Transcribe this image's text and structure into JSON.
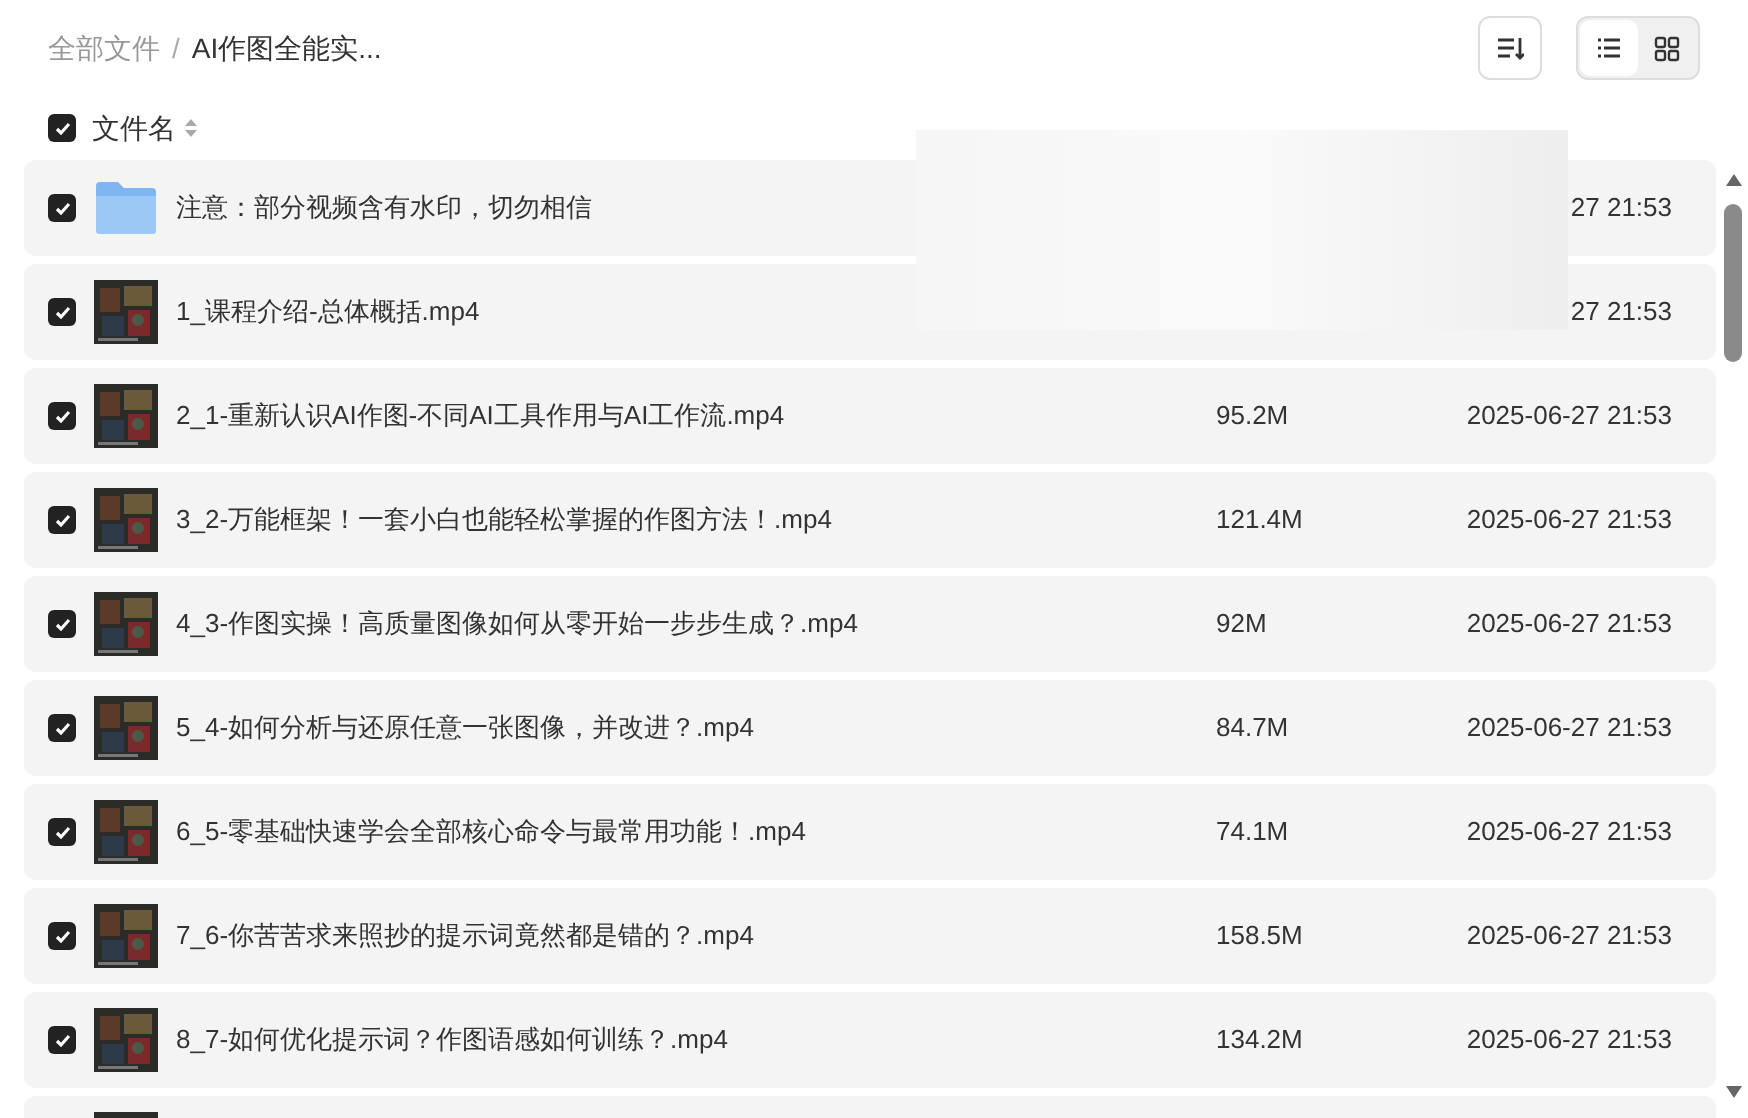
{
  "breadcrumb": {
    "items": [
      "全部文件",
      "AI作图全能实..."
    ],
    "separator": "/"
  },
  "view_modes": [
    {
      "kind": "list",
      "selected": true
    },
    {
      "kind": "grid",
      "selected": false
    }
  ],
  "header": {
    "checked": true,
    "columns": [
      "文件名"
    ]
  },
  "rows": [
    {
      "kind": "folder",
      "checked": true,
      "name": "注意：部分视频含有水印，切勿相信",
      "date": "27 21:53"
    },
    {
      "kind": "video",
      "checked": true,
      "name": "1_课程介绍-总体概括.mp4",
      "date": "27 21:53"
    },
    {
      "kind": "video",
      "checked": true,
      "name": "2_1-重新认识AI作图-不同AI工具作用与AI工作流.mp4",
      "size": "95.2M",
      "date": "2025-06-27 21:53"
    },
    {
      "kind": "video",
      "checked": true,
      "name": "3_2-万能框架！一套小白也能轻松掌握的作图方法！.mp4",
      "size": "121.4M",
      "date": "2025-06-27 21:53"
    },
    {
      "kind": "video",
      "checked": true,
      "name": "4_3-作图实操！高质量图像如何从零开始一步步生成？.mp4",
      "size": "92M",
      "date": "2025-06-27 21:53"
    },
    {
      "kind": "video",
      "checked": true,
      "name": "5_4-如何分析与还原任意一张图像，并改进？.mp4",
      "size": "84.7M",
      "date": "2025-06-27 21:53"
    },
    {
      "kind": "video",
      "checked": true,
      "name": "6_5-零基础快速学会全部核心命令与最常用功能！.mp4",
      "size": "74.1M",
      "date": "2025-06-27 21:53"
    },
    {
      "kind": "video",
      "checked": true,
      "name": "7_6-你苦苦求来照抄的提示词竟然都是错的？.mp4",
      "size": "158.5M",
      "date": "2025-06-27 21:53"
    },
    {
      "kind": "video",
      "checked": true,
      "name": "8_7-如何优化提示词？作图语感如何训练？.mp4",
      "size": "134.2M",
      "date": "2025-06-27 21:53"
    },
    {
      "kind": "video"
    }
  ]
}
